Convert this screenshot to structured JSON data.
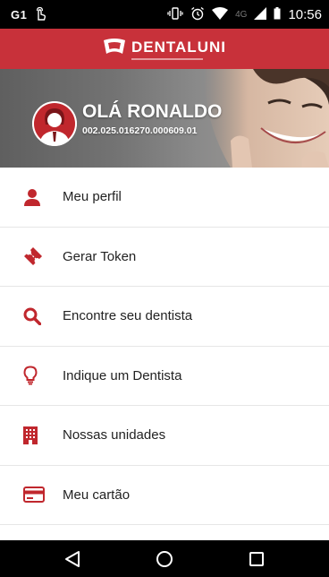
{
  "status_bar": {
    "carrier": "G1",
    "network": "4G",
    "time": "10:56"
  },
  "header": {
    "logo_text": "DENTALUNI"
  },
  "profile": {
    "greeting": "OLÁ RONALDO",
    "card_number": "002.025.016270.000609.01"
  },
  "menu": {
    "items": [
      {
        "label": "Meu perfil",
        "icon": "user-icon"
      },
      {
        "label": "Gerar Token",
        "icon": "ticket-icon"
      },
      {
        "label": "Encontre seu dentista",
        "icon": "search-icon"
      },
      {
        "label": "Indique um Dentista",
        "icon": "lightbulb-icon"
      },
      {
        "label": "Nossas unidades",
        "icon": "building-icon"
      },
      {
        "label": "Meu cartão",
        "icon": "credit-card-icon"
      }
    ]
  },
  "colors": {
    "brand_red": "#c8313a",
    "icon_red": "#c0272d"
  }
}
